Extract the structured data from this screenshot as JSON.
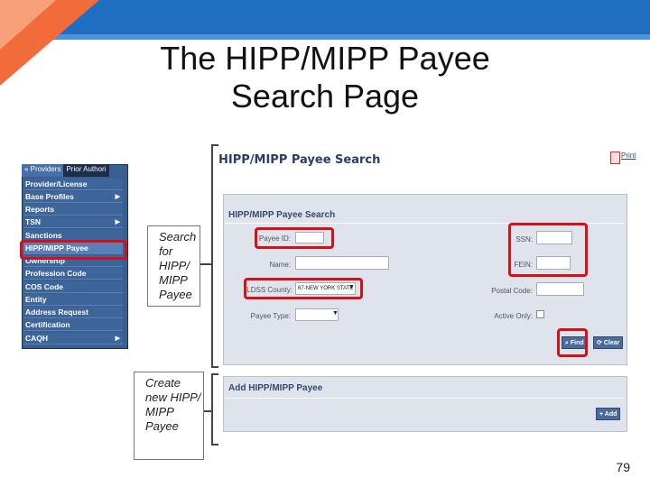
{
  "slide": {
    "title_line1": "The HIPP/MIPP Payee",
    "title_line2": "Search Page",
    "page_number": "79",
    "colors": {
      "header_blue": "#1f6ec2",
      "accent_orange": "#f26b3a",
      "highlight_red": "#d80f16"
    }
  },
  "menu": {
    "tabs": [
      "« Providers",
      "Prior Authori"
    ],
    "items": [
      {
        "label": "Provider/License",
        "arrow": false
      },
      {
        "label": "Base Profiles",
        "arrow": true
      },
      {
        "label": "Reports",
        "arrow": false
      },
      {
        "label": "TSN",
        "arrow": true
      },
      {
        "label": "Sanctions",
        "arrow": false
      },
      {
        "label": "HIPP/MIPP Payee",
        "arrow": false
      },
      {
        "label": "Ownership",
        "arrow": false
      },
      {
        "label": "Profession Code",
        "arrow": false
      },
      {
        "label": "COS Code",
        "arrow": false
      },
      {
        "label": "Entity",
        "arrow": false
      },
      {
        "label": "Address Request",
        "arrow": false
      },
      {
        "label": "Certification",
        "arrow": false
      },
      {
        "label": "CAQH",
        "arrow": true
      }
    ]
  },
  "callouts": {
    "search": "Search for HIPP/ MIPP Payee",
    "create": "Create new HIPP/ MIPP Payee"
  },
  "app": {
    "page_title": "HIPP/MIPP Payee Search",
    "print_link": "Print",
    "search_panel": {
      "title": "HIPP/MIPP Payee Search",
      "payee_id_label": "Payee ID:",
      "name_label": "Name:",
      "ldss_county_label": "LDSS County:",
      "ldss_county_value": "67-NEW YORK STATE",
      "payee_type_label": "Payee Type:",
      "payee_type_value": "",
      "ssn_label": "SSN:",
      "fein_label": "FEIN:",
      "postal_code_label": "Postal Code:",
      "active_only_label": "Active Only:",
      "find_button": "Find",
      "clear_button": "Clear"
    },
    "add_panel": {
      "title": "Add HIPP/MIPP Payee",
      "add_button": "Add"
    }
  }
}
